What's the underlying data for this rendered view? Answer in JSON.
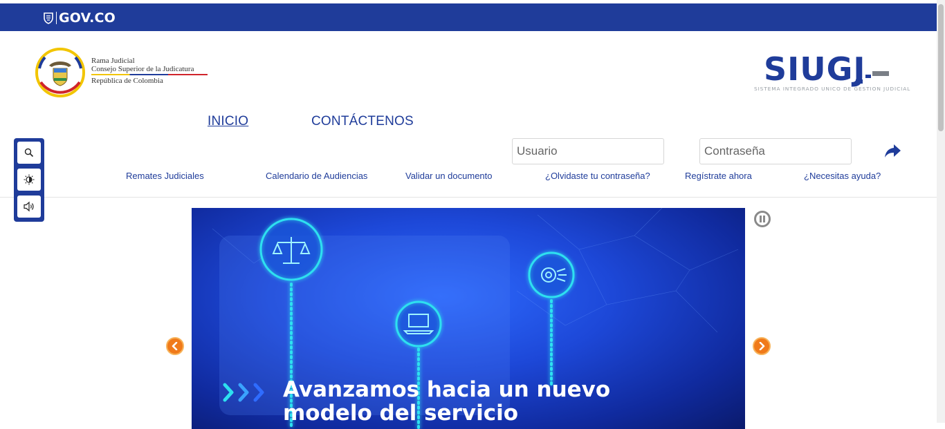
{
  "gov_bar": {
    "logo_text": "GOV.CO"
  },
  "institution": {
    "line1": "Rama Judicial",
    "line2": "Consejo Superior de la Judicatura",
    "line3": "República de Colombia"
  },
  "brand": {
    "name": "SIUGJ",
    "subtitle": "SISTEMA INTEGRADO UNICO DE GESTION JUDICIAL"
  },
  "nav": {
    "items": [
      {
        "label": "INICIO",
        "active": true
      },
      {
        "label": "CONTÁCTENOS",
        "active": false
      }
    ]
  },
  "login": {
    "user_placeholder": "Usuario",
    "password_placeholder": "Contraseña",
    "submit_icon": "share-arrow-icon"
  },
  "links": {
    "remates": "Remates Judiciales",
    "calendario": "Calendario de Audiencias",
    "validar": "Validar un documento",
    "olvidaste": "¿Olvidaste tu contraseña?",
    "registrate": "Regístrate ahora",
    "ayuda": "¿Necesitas ayuda?"
  },
  "accessibility": {
    "icons": [
      "search-icon",
      "contrast-icon",
      "audio-icon"
    ]
  },
  "carousel": {
    "slide_title": "Avanzamos hacia un nuevo modelo del servicio",
    "prev_icon": "chevron-left-icon",
    "next_icon": "chevron-right-icon",
    "pause_icon": "pause-icon"
  },
  "colors": {
    "gov_blue": "#1f3c9a",
    "accent_orange": "#f07a1a",
    "slide_cyan": "#2de0f0"
  }
}
